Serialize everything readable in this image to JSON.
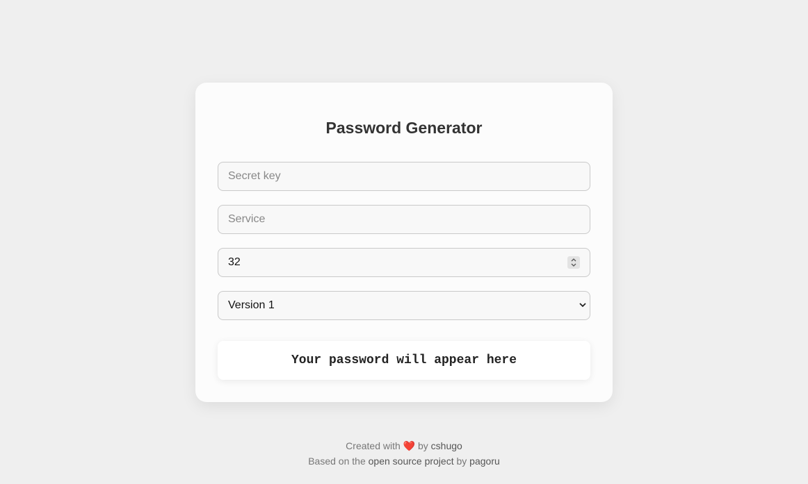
{
  "app": {
    "title": "Password Generator"
  },
  "form": {
    "secret_placeholder": "Secret key",
    "service_placeholder": "Service",
    "length_value": "32",
    "version_selected": "Version 1"
  },
  "output": {
    "placeholder_text": "Your password will appear here"
  },
  "footer": {
    "line1_prefix": "Created with",
    "heart": "❤️",
    "line1_by": "by",
    "line1_author": "cshugo",
    "line2_prefix": "Based on the",
    "line2_link": "open source project",
    "line2_by": "by",
    "line2_author": "pagoru"
  },
  "colors": {
    "background": "#efefef",
    "card": "#fcfcfc",
    "heart": "#e84a4a"
  }
}
